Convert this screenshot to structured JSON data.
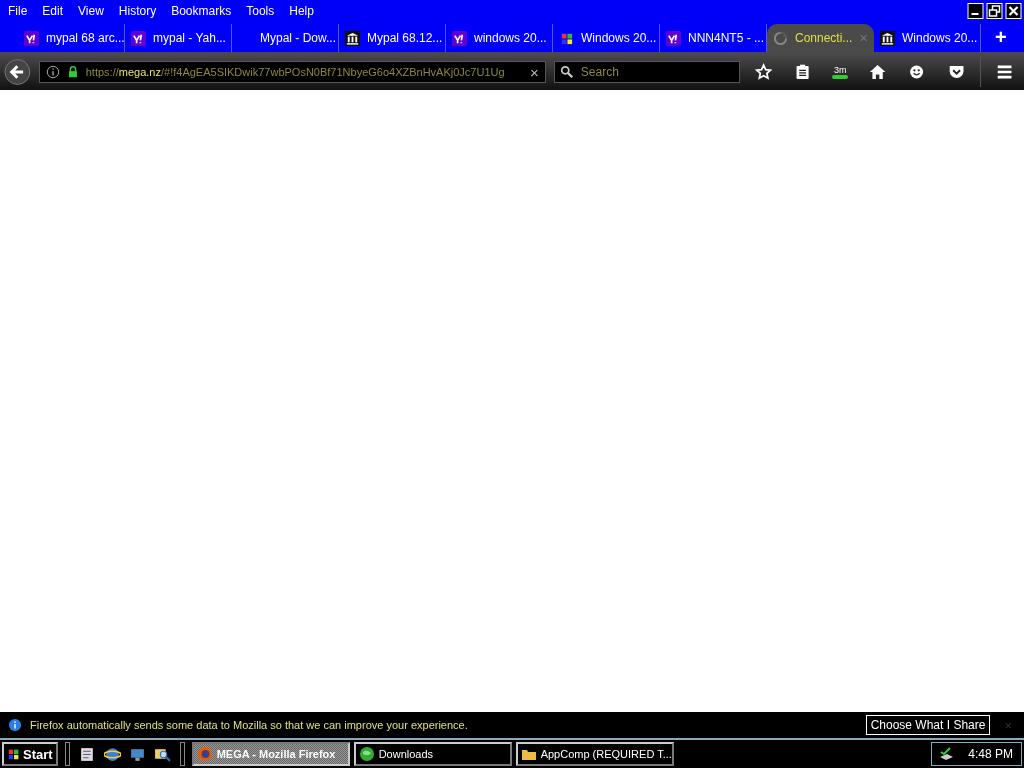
{
  "menu": [
    "File",
    "Edit",
    "View",
    "History",
    "Bookmarks",
    "Tools",
    "Help"
  ],
  "tabs": [
    {
      "label": "mypal 68 arc...",
      "kind": "yahoo",
      "selected": false
    },
    {
      "label": "mypal - Yah...",
      "kind": "yahoo",
      "selected": false
    },
    {
      "label": "Mypal - Dow...",
      "kind": "blank",
      "selected": false
    },
    {
      "label": "Mypal 68.12...",
      "kind": "museum",
      "selected": false
    },
    {
      "label": "windows 20...",
      "kind": "yahoo",
      "selected": false
    },
    {
      "label": "Windows 20...",
      "kind": "windows",
      "selected": false
    },
    {
      "label": "NNN4NT5 - ...",
      "kind": "yahoo",
      "selected": false
    },
    {
      "label": "Connecti...",
      "kind": "loading",
      "selected": true
    },
    {
      "label": "Windows 20...",
      "kind": "museum",
      "selected": false
    }
  ],
  "new_tab": "+",
  "url": {
    "scheme": "https://",
    "host": "mega.nz",
    "path": "/#!f4AgEA5SIKDwik77wbPOsN0Bf71NbyeG6o4XZBnHvAKj0Jc7U1Ug"
  },
  "clear": "×",
  "search": {
    "placeholder": "Search"
  },
  "badge": "3m",
  "notification": {
    "text": "Firefox automatically sends some data to Mozilla so that we can improve your experience.",
    "button": "Choose What I Share",
    "close": "×"
  },
  "taskbar": {
    "start": "Start",
    "tasks": [
      {
        "label": "MEGA - Mozilla Firefox",
        "kind": "firefox",
        "selected": true
      },
      {
        "label": "Downloads",
        "kind": "globe",
        "selected": false
      },
      {
        "label": "AppComp (REQUIRED T...",
        "kind": "folder",
        "selected": false
      }
    ],
    "clock": "4:48 PM"
  }
}
